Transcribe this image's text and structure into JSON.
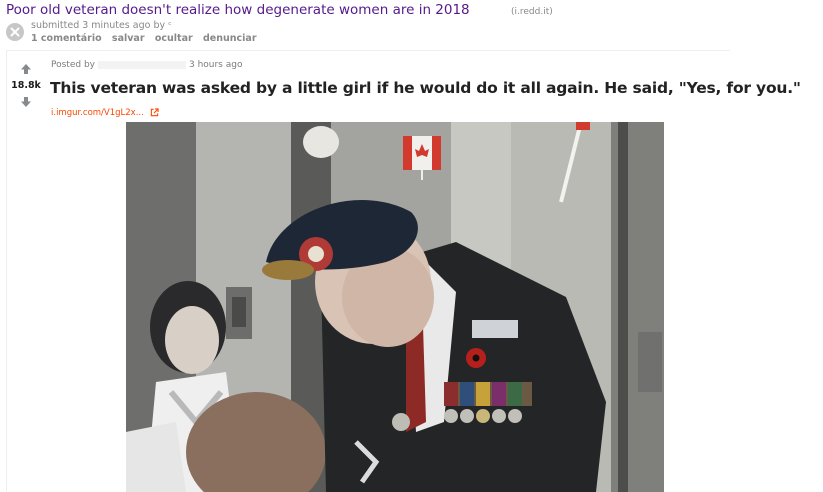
{
  "old_reddit": {
    "title": "Poor old veteran doesn't realize how degenerate women are in 2018",
    "domain": "(i.redd.it)",
    "submitted": "submitted 3 minutes ago by",
    "author": "ᶜ",
    "actions": [
      "1 comentário",
      "salvar",
      "ocultar",
      "denunciar"
    ]
  },
  "embedded_post": {
    "score": "18.8k",
    "posted_by": "Posted by",
    "time": "3 hours ago",
    "title": "This veteran was asked by a little girl if he would do it all again. He said, \"Yes, for you.\"",
    "link": "i.imgur.com/V1gL2x...",
    "colors": {
      "link": "#ff4500",
      "visited_title": "#551a8b"
    }
  },
  "icons": [
    "close-icon",
    "upvote-icon",
    "downvote-icon",
    "external-link-icon"
  ]
}
